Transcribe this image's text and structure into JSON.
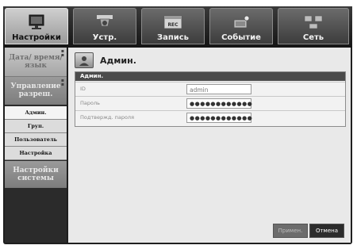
{
  "tabs": [
    {
      "label": "Настройки",
      "icon": "setup-monitor-icon",
      "active": true
    },
    {
      "label": "Устр.",
      "icon": "camera-icon",
      "active": false
    },
    {
      "label": "Запись",
      "icon": "record-icon",
      "active": false
    },
    {
      "label": "Событие",
      "icon": "event-icon",
      "active": false
    },
    {
      "label": "Сеть",
      "icon": "network-icon",
      "active": false
    }
  ],
  "sidebar": {
    "sections": [
      {
        "label": "Дата/ время/ язык"
      },
      {
        "label": "Управление разреш."
      },
      {
        "label": "Настройки системы"
      }
    ],
    "subitems": [
      {
        "label": "Админ."
      },
      {
        "label": "Груп."
      },
      {
        "label": "Пользователь"
      },
      {
        "label": "Настройка"
      }
    ]
  },
  "page": {
    "title": "Админ.",
    "panel_title": "Админ.",
    "fields": [
      {
        "label": "ID",
        "value": "admin"
      },
      {
        "label": "Пароль",
        "value": "●●●●●●●●●●●●"
      },
      {
        "label": "Подтвержд. пароля",
        "value": "●●●●●●●●●●●●"
      }
    ]
  },
  "buttons": {
    "apply": "Примен.",
    "cancel": "Отмена"
  }
}
